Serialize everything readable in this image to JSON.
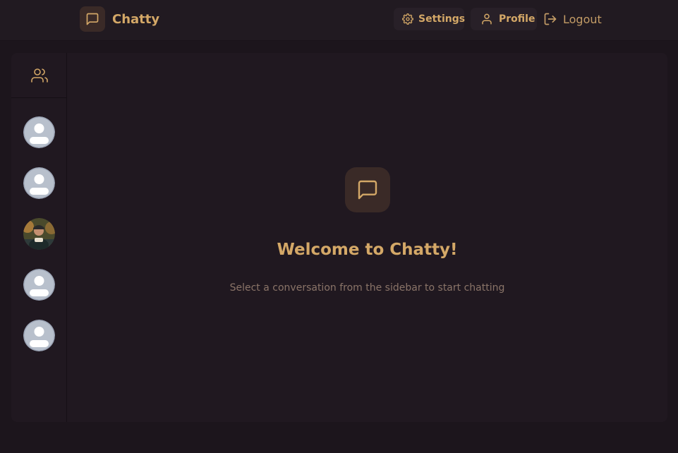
{
  "app": {
    "name": "Chatty",
    "icon": "message-square-icon",
    "accent_color": "#d4a867",
    "background_color": "#1c151c"
  },
  "navbar": {
    "settings_label": "Settings",
    "settings_icon": "gear-icon",
    "profile_label": "Profile",
    "profile_icon": "user-icon",
    "logout_label": "Logout",
    "logout_icon": "logout-icon"
  },
  "sidebar": {
    "header_icon": "users-icon",
    "contacts": [
      {
        "avatar": "default-avatar"
      },
      {
        "avatar": "default-avatar"
      },
      {
        "avatar": "photo-avatar"
      },
      {
        "avatar": "default-avatar"
      },
      {
        "avatar": "default-avatar"
      }
    ]
  },
  "welcome": {
    "icon": "message-square-icon",
    "title": "Welcome to Chatty!",
    "subtitle": "Select a conversation from the sidebar to start chatting"
  }
}
